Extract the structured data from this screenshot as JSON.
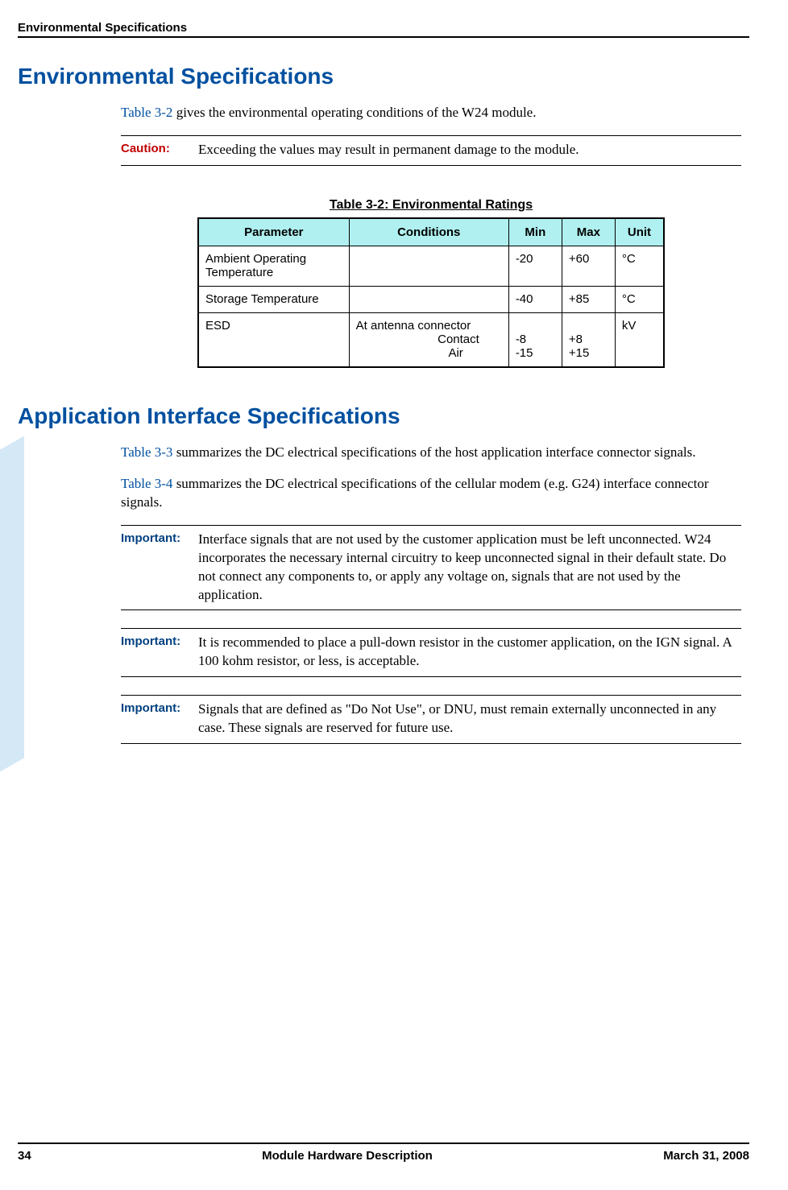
{
  "running_head": "Environmental Specifications",
  "section1": {
    "title": "Environmental Specifications",
    "intro_link": "Table 3-2",
    "intro_rest": " gives the environmental operating conditions of the W24 module.",
    "caution_label": "Caution:",
    "caution_text": "Exceeding the values may result in permanent damage to the module.",
    "table_caption": "Table 3-2: Environmental Ratings",
    "headers": {
      "param": "Parameter",
      "cond": "Conditions",
      "min": "Min",
      "max": "Max",
      "unit": "Unit"
    },
    "rows": [
      {
        "param": "Ambient Operating Temperature",
        "cond": "",
        "min": "-20",
        "max": "+60",
        "unit": "°C"
      },
      {
        "param": "Storage Temperature",
        "cond": "",
        "min": "-40",
        "max": "+85",
        "unit": "°C"
      },
      {
        "param": "ESD",
        "cond_l1": "At antenna connector",
        "cond_l2": "Contact",
        "cond_l3": "Air",
        "min_l1": "",
        "min_l2": "-8",
        "min_l3": "-15",
        "max_l1": "",
        "max_l2": "+8",
        "max_l3": "+15",
        "unit": "kV"
      }
    ]
  },
  "section2": {
    "title": "Application Interface Specifications",
    "p1_link": "Table 3-3",
    "p1_rest": " summarizes the DC electrical specifications of the host application interface connector signals.",
    "p2_link": "Table 3-4",
    "p2_rest": " summarizes the DC electrical specifications of the cellular modem (e.g. G24) interface connector signals.",
    "imp_label": "Important:",
    "imp1": "Interface signals that are not used by the customer application must be left unconnected. W24 incorporates the necessary internal circuitry to keep unconnected signal in their default state. Do not connect any components to, or apply any voltage on, signals that are not used by the application.",
    "imp2": "It is recommended to place a pull-down resistor in the customer application, on the IGN signal. A 100 kohm resistor, or less, is acceptable.",
    "imp3": "Signals that are defined as \"Do Not Use\", or DNU, must remain externally unconnected in any case. These signals are reserved for future use."
  },
  "footer": {
    "page": "34",
    "title": "Module Hardware Description",
    "date": "March 31, 2008"
  }
}
